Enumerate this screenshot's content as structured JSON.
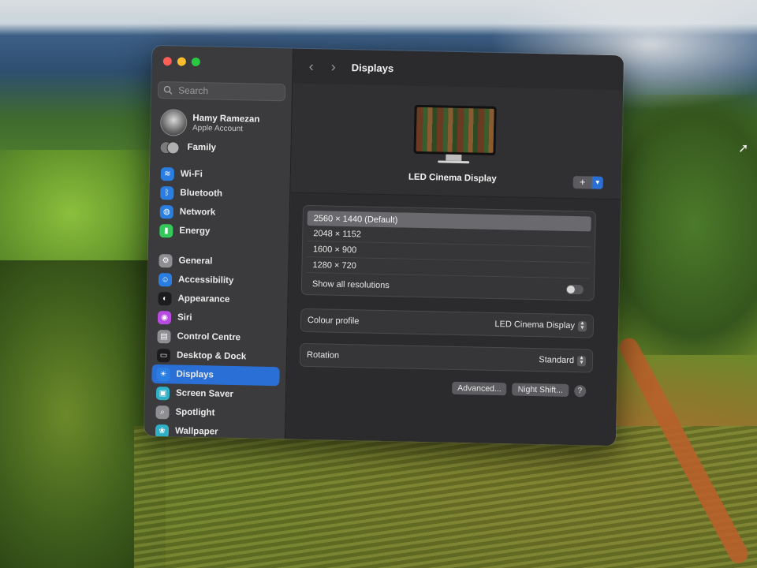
{
  "colors": {
    "accent": "#2a6fd6",
    "traffic_red": "#ff5f57",
    "traffic_yellow": "#febc2e",
    "traffic_green": "#28c840"
  },
  "sidebar": {
    "search_placeholder": "Search",
    "account": {
      "name": "Hamy Ramezan",
      "subtitle": "Apple Account"
    },
    "family_label": "Family",
    "groups": [
      {
        "items": [
          {
            "label": "Wi-Fi",
            "icon": "wifi-icon",
            "color": "#2a7de1"
          },
          {
            "label": "Bluetooth",
            "icon": "bluetooth-icon",
            "color": "#2a7de1"
          },
          {
            "label": "Network",
            "icon": "globe-icon",
            "color": "#2a7de1"
          },
          {
            "label": "Energy",
            "icon": "battery-icon",
            "color": "#34c759"
          }
        ]
      },
      {
        "items": [
          {
            "label": "General",
            "icon": "gear-icon",
            "color": "#8e8e93"
          },
          {
            "label": "Accessibility",
            "icon": "accessibility-icon",
            "color": "#2a7de1"
          },
          {
            "label": "Appearance",
            "icon": "appearance-icon",
            "color": "#1c1c1e"
          },
          {
            "label": "Siri",
            "icon": "siri-icon",
            "color": "#b84be0"
          },
          {
            "label": "Control Centre",
            "icon": "control-centre-icon",
            "color": "#8e8e93"
          },
          {
            "label": "Desktop & Dock",
            "icon": "dock-icon",
            "color": "#1c1c1e"
          },
          {
            "label": "Displays",
            "icon": "sun-icon",
            "color": "#2a7de1",
            "active": true
          },
          {
            "label": "Screen Saver",
            "icon": "screen-saver-icon",
            "color": "#30b0c7"
          },
          {
            "label": "Spotlight",
            "icon": "magnifier-icon",
            "color": "#8e8e93"
          },
          {
            "label": "Wallpaper",
            "icon": "wallpaper-icon",
            "color": "#30b0c7"
          }
        ]
      }
    ]
  },
  "main": {
    "title": "Displays",
    "display_name": "LED Cinema Display",
    "add_button": "+",
    "resolutions": [
      {
        "label": "2560 × 1440 (Default)",
        "selected": true
      },
      {
        "label": "2048 × 1152",
        "selected": false
      },
      {
        "label": "1600 × 900",
        "selected": false
      },
      {
        "label": "1280 × 720",
        "selected": false
      }
    ],
    "show_all_label": "Show all resolutions",
    "show_all_on": false,
    "colour_profile": {
      "label": "Colour profile",
      "value": "LED Cinema Display"
    },
    "rotation": {
      "label": "Rotation",
      "value": "Standard"
    },
    "advanced_label": "Advanced...",
    "night_shift_label": "Night Shift...",
    "help_label": "?"
  }
}
